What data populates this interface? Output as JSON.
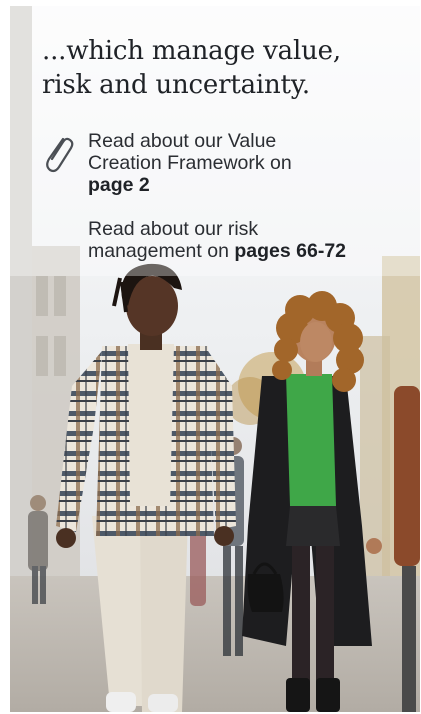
{
  "headline": {
    "line1": "...which manage value,",
    "line2": "risk and uncertainty."
  },
  "references": [
    {
      "text_line1": "Read about our Value",
      "text_line2": "Creation Framework on",
      "link": "page 2"
    },
    {
      "text_line1": "Read about our risk",
      "text_line2_prefix": "management on ",
      "link": "pages 66-72"
    }
  ],
  "icons": {
    "reference": "paperclip-icon"
  }
}
